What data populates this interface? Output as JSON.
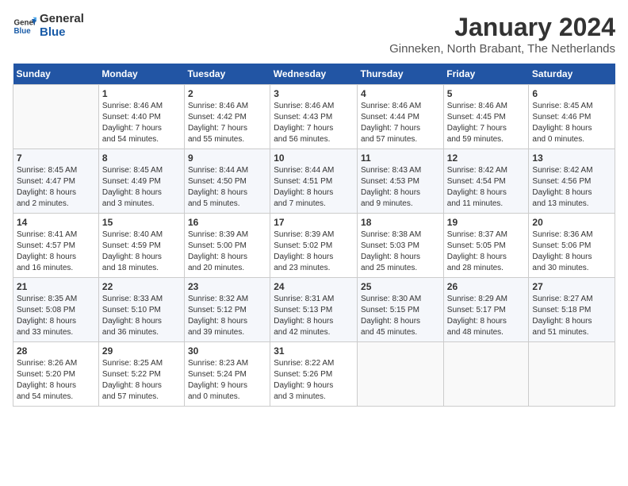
{
  "logo": {
    "line1": "General",
    "line2": "Blue"
  },
  "title": "January 2024",
  "subtitle": "Ginneken, North Brabant, The Netherlands",
  "headers": [
    "Sunday",
    "Monday",
    "Tuesday",
    "Wednesday",
    "Thursday",
    "Friday",
    "Saturday"
  ],
  "weeks": [
    [
      {
        "day": "",
        "info": ""
      },
      {
        "day": "1",
        "info": "Sunrise: 8:46 AM\nSunset: 4:40 PM\nDaylight: 7 hours\nand 54 minutes."
      },
      {
        "day": "2",
        "info": "Sunrise: 8:46 AM\nSunset: 4:42 PM\nDaylight: 7 hours\nand 55 minutes."
      },
      {
        "day": "3",
        "info": "Sunrise: 8:46 AM\nSunset: 4:43 PM\nDaylight: 7 hours\nand 56 minutes."
      },
      {
        "day": "4",
        "info": "Sunrise: 8:46 AM\nSunset: 4:44 PM\nDaylight: 7 hours\nand 57 minutes."
      },
      {
        "day": "5",
        "info": "Sunrise: 8:46 AM\nSunset: 4:45 PM\nDaylight: 7 hours\nand 59 minutes."
      },
      {
        "day": "6",
        "info": "Sunrise: 8:45 AM\nSunset: 4:46 PM\nDaylight: 8 hours\nand 0 minutes."
      }
    ],
    [
      {
        "day": "7",
        "info": "Sunrise: 8:45 AM\nSunset: 4:47 PM\nDaylight: 8 hours\nand 2 minutes."
      },
      {
        "day": "8",
        "info": "Sunrise: 8:45 AM\nSunset: 4:49 PM\nDaylight: 8 hours\nand 3 minutes."
      },
      {
        "day": "9",
        "info": "Sunrise: 8:44 AM\nSunset: 4:50 PM\nDaylight: 8 hours\nand 5 minutes."
      },
      {
        "day": "10",
        "info": "Sunrise: 8:44 AM\nSunset: 4:51 PM\nDaylight: 8 hours\nand 7 minutes."
      },
      {
        "day": "11",
        "info": "Sunrise: 8:43 AM\nSunset: 4:53 PM\nDaylight: 8 hours\nand 9 minutes."
      },
      {
        "day": "12",
        "info": "Sunrise: 8:42 AM\nSunset: 4:54 PM\nDaylight: 8 hours\nand 11 minutes."
      },
      {
        "day": "13",
        "info": "Sunrise: 8:42 AM\nSunset: 4:56 PM\nDaylight: 8 hours\nand 13 minutes."
      }
    ],
    [
      {
        "day": "14",
        "info": "Sunrise: 8:41 AM\nSunset: 4:57 PM\nDaylight: 8 hours\nand 16 minutes."
      },
      {
        "day": "15",
        "info": "Sunrise: 8:40 AM\nSunset: 4:59 PM\nDaylight: 8 hours\nand 18 minutes."
      },
      {
        "day": "16",
        "info": "Sunrise: 8:39 AM\nSunset: 5:00 PM\nDaylight: 8 hours\nand 20 minutes."
      },
      {
        "day": "17",
        "info": "Sunrise: 8:39 AM\nSunset: 5:02 PM\nDaylight: 8 hours\nand 23 minutes."
      },
      {
        "day": "18",
        "info": "Sunrise: 8:38 AM\nSunset: 5:03 PM\nDaylight: 8 hours\nand 25 minutes."
      },
      {
        "day": "19",
        "info": "Sunrise: 8:37 AM\nSunset: 5:05 PM\nDaylight: 8 hours\nand 28 minutes."
      },
      {
        "day": "20",
        "info": "Sunrise: 8:36 AM\nSunset: 5:06 PM\nDaylight: 8 hours\nand 30 minutes."
      }
    ],
    [
      {
        "day": "21",
        "info": "Sunrise: 8:35 AM\nSunset: 5:08 PM\nDaylight: 8 hours\nand 33 minutes."
      },
      {
        "day": "22",
        "info": "Sunrise: 8:33 AM\nSunset: 5:10 PM\nDaylight: 8 hours\nand 36 minutes."
      },
      {
        "day": "23",
        "info": "Sunrise: 8:32 AM\nSunset: 5:12 PM\nDaylight: 8 hours\nand 39 minutes."
      },
      {
        "day": "24",
        "info": "Sunrise: 8:31 AM\nSunset: 5:13 PM\nDaylight: 8 hours\nand 42 minutes."
      },
      {
        "day": "25",
        "info": "Sunrise: 8:30 AM\nSunset: 5:15 PM\nDaylight: 8 hours\nand 45 minutes."
      },
      {
        "day": "26",
        "info": "Sunrise: 8:29 AM\nSunset: 5:17 PM\nDaylight: 8 hours\nand 48 minutes."
      },
      {
        "day": "27",
        "info": "Sunrise: 8:27 AM\nSunset: 5:18 PM\nDaylight: 8 hours\nand 51 minutes."
      }
    ],
    [
      {
        "day": "28",
        "info": "Sunrise: 8:26 AM\nSunset: 5:20 PM\nDaylight: 8 hours\nand 54 minutes."
      },
      {
        "day": "29",
        "info": "Sunrise: 8:25 AM\nSunset: 5:22 PM\nDaylight: 8 hours\nand 57 minutes."
      },
      {
        "day": "30",
        "info": "Sunrise: 8:23 AM\nSunset: 5:24 PM\nDaylight: 9 hours\nand 0 minutes."
      },
      {
        "day": "31",
        "info": "Sunrise: 8:22 AM\nSunset: 5:26 PM\nDaylight: 9 hours\nand 3 minutes."
      },
      {
        "day": "",
        "info": ""
      },
      {
        "day": "",
        "info": ""
      },
      {
        "day": "",
        "info": ""
      }
    ]
  ]
}
